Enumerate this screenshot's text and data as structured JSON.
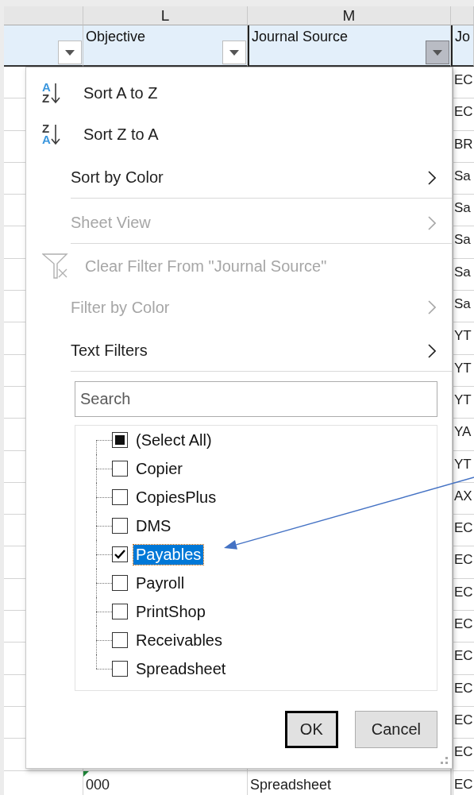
{
  "columns": [
    {
      "filter_open": false
    },
    {
      "letter": "L",
      "heading": "Objective",
      "filter_open": false
    },
    {
      "letter": "M",
      "heading": "Journal Source",
      "filter_open": true
    },
    {
      "heading": "Jo"
    }
  ],
  "rows": [
    {
      "column_n": "EC"
    },
    {
      "column_n": "EC"
    },
    {
      "column_n": "BR"
    },
    {
      "column_n": "Sa"
    },
    {
      "column_n": "Sa"
    },
    {
      "column_n": "Sa"
    },
    {
      "column_n": "Sa"
    },
    {
      "column_n": "Sa"
    },
    {
      "column_n": "YT"
    },
    {
      "column_n": "YT"
    },
    {
      "column_n": "YT"
    },
    {
      "column_n": "YA"
    },
    {
      "column_n": "YT"
    },
    {
      "column_n": "AX"
    },
    {
      "column_n": "EC"
    },
    {
      "column_n": "EC"
    },
    {
      "column_n": "EC"
    },
    {
      "column_n": "EC"
    },
    {
      "column_n": "EC"
    },
    {
      "column_n": "EC"
    },
    {
      "column_n": "EC"
    },
    {
      "column_n": "EC"
    },
    {
      "column_l": "000",
      "column_l_warning": true,
      "column_m": "Spreadsheet",
      "column_n": "EC"
    }
  ],
  "filter_menu": {
    "items": [
      {
        "kind": "sort_ascending",
        "label": "Sort A to Z",
        "icon_top": "A",
        "icon_bottom": "Z",
        "disabled": false,
        "submenu": false,
        "separator_after": false
      },
      {
        "kind": "sort_descending",
        "label": "Sort Z to A",
        "icon_top": "Z",
        "icon_bottom": "A",
        "disabled": false,
        "submenu": false,
        "separator_after": false
      },
      {
        "kind": "plain",
        "label": "Sort by Color",
        "disabled": false,
        "submenu": true,
        "separator_after": true
      },
      {
        "kind": "plain",
        "label": "Sheet View",
        "disabled": true,
        "submenu": true,
        "separator_after": true
      },
      {
        "kind": "clear_filter",
        "label": "Clear Filter From \"Journal Source\"",
        "disabled": true,
        "submenu": false,
        "separator_after": false
      },
      {
        "kind": "plain",
        "label": "Filter by Color",
        "disabled": true,
        "submenu": true,
        "separator_after": false
      },
      {
        "kind": "plain",
        "label": "Text Filters",
        "disabled": false,
        "submenu": true,
        "separator_after": true
      }
    ],
    "search": {
      "placeholder": "Search"
    },
    "values": [
      {
        "label": "(Select All)",
        "checked": false,
        "mixed": true,
        "selected": false
      },
      {
        "label": "Copier",
        "checked": false,
        "selected": false
      },
      {
        "label": "CopiesPlus",
        "checked": false,
        "selected": false
      },
      {
        "label": "DMS",
        "checked": false,
        "selected": false
      },
      {
        "label": "Payables",
        "checked": true,
        "selected": true
      },
      {
        "label": "Payroll",
        "checked": false,
        "selected": false
      },
      {
        "label": "PrintShop",
        "checked": false,
        "selected": false
      },
      {
        "label": "Receivables",
        "checked": false,
        "selected": false
      },
      {
        "label": "Spreadsheet",
        "checked": false,
        "selected": false
      }
    ],
    "buttons": [
      {
        "label": "OK",
        "default": true
      },
      {
        "label": "Cancel",
        "default": false
      }
    ]
  },
  "annotation": {
    "arrow": true
  }
}
